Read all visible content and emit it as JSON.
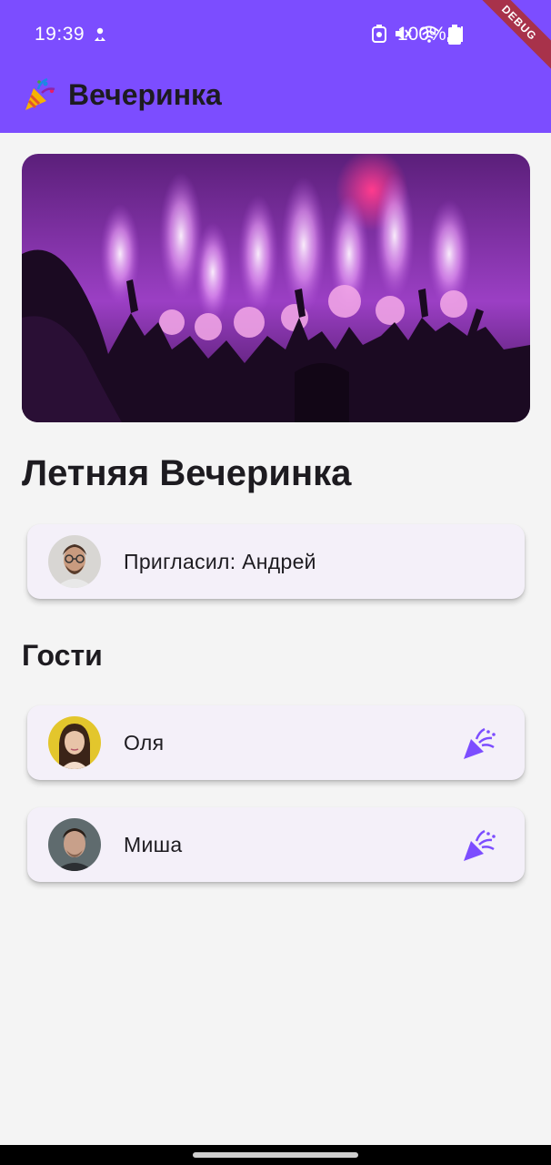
{
  "status_bar": {
    "time": "19:39",
    "battery": "100%",
    "icons": [
      "person-icon",
      "alarm-icon",
      "mute-icon",
      "wifi-icon",
      "signal-icon",
      "battery-icon"
    ]
  },
  "debug_banner": "DEBUG",
  "app_bar": {
    "title": "Вечеринка",
    "icon": "party-popper-icon"
  },
  "event": {
    "title": "Летняя Вечеринка",
    "hero_image": "concert-crowd-fireworks-photo"
  },
  "host": {
    "label": "Пригласил: Андрей",
    "avatar": "man-glasses-avatar"
  },
  "guests_heading": "Гости",
  "guests": [
    {
      "name": "Оля",
      "avatar": "woman-avatar",
      "action_icon": "party-popper-icon"
    },
    {
      "name": "Миша",
      "avatar": "man-avatar",
      "action_icon": "party-popper-icon"
    }
  ],
  "colors": {
    "primary": "#7c4dff",
    "card": "#f4f0f9",
    "background": "#f4f4f4",
    "accent_icon": "#7c4dff"
  }
}
